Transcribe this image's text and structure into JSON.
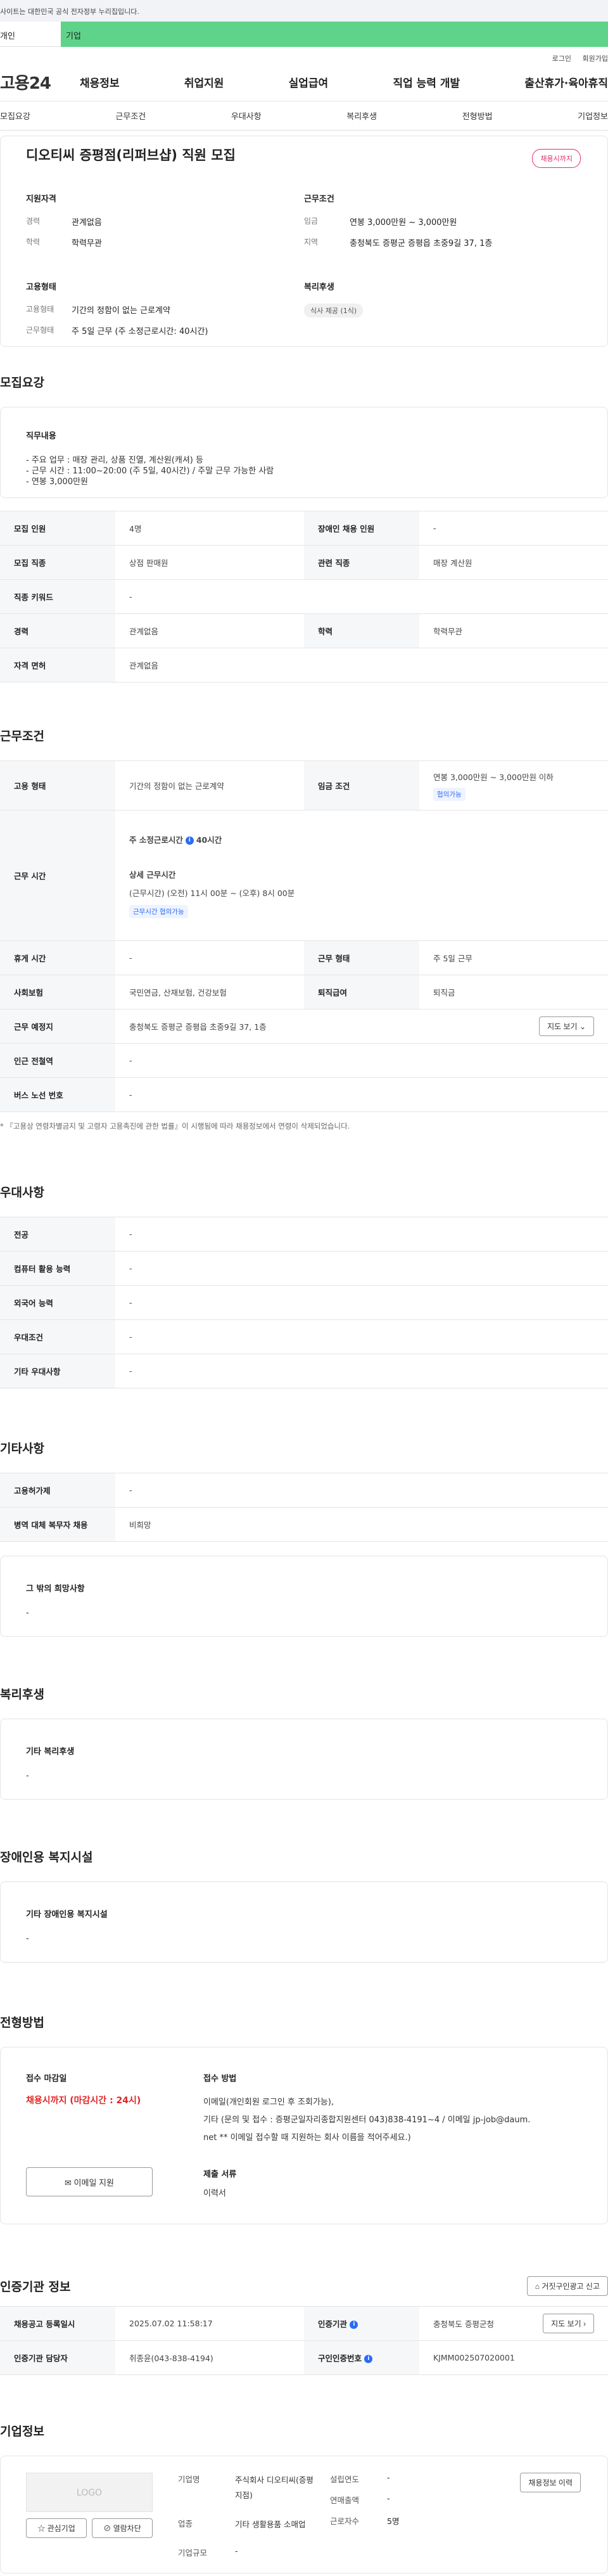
{
  "gov_banner": {
    "text": "사이트는 대한민국 공식 전자정부 누리집입니다."
  },
  "top_tabs": {
    "personal": "개인",
    "company": "기업"
  },
  "util_links": {
    "login": "로그인",
    "join": "회원가입"
  },
  "gnb": {
    "logo": "고용24",
    "items": [
      "채용정보",
      "취업지원",
      "실업급여",
      "직업 능력 개발",
      "출산휴가·육아휴직"
    ]
  },
  "subnav": [
    "모집요강",
    "근무조건",
    "우대사항",
    "복리후생",
    "전형방법",
    "기업정보"
  ],
  "summary": {
    "title": "디오티씨 증평점(리퍼브샵) 직원 모집",
    "status_badge": "채용시까지",
    "qual_head": "지원자격",
    "career_k": "경력",
    "career_v": "관계없음",
    "edu_k": "학력",
    "edu_v": "학력무관",
    "cond_head": "근무조건",
    "wage_k": "임금",
    "wage_v": "연봉 3,000만원 ~ 3,000만원",
    "region_k": "지역",
    "region_v": "충청북도 증평군 증평읍 초중9길 37, 1층",
    "emp_head": "고용형태",
    "emptype_k": "고용형태",
    "emptype_v": "기간의 정함이 없는 근로계약",
    "worktype_k": "근무형태",
    "worktype_v": "주 5일 근무 (주 소정근로시간: 40시간)",
    "welfare_head": "복리후생",
    "welfare_chip": "식사 제공 (1식)"
  },
  "recruit": {
    "section_title": "모집요강",
    "duty_title": "직무내용",
    "duty_lines": [
      "- 주요 업무 : 매장 관리, 상품 진열, 계산원(캐셔) 등",
      "- 근무 시간 : 11:00~20:00 (주 5일, 40시간) / 주말 근무 가능한 사람",
      "- 연봉 3,000만원"
    ],
    "people_k": "모집 인원",
    "people_v": "4명",
    "disabled_k": "장애인 채용 인원",
    "disabled_v": "-",
    "job_k": "모집 직종",
    "job_v": "상점 판매원",
    "related_k": "관련 직종",
    "related_v": "매장 계산원",
    "keyword_k": "직종 키워드",
    "keyword_v": "-",
    "career_k": "경력",
    "career_v": "관계없음",
    "edu_k": "학력",
    "edu_v": "학력무관",
    "license_k": "자격 면허",
    "license_v": "관계없음"
  },
  "conditions": {
    "section_title": "근무조건",
    "emptype_k": "고용 형태",
    "emptype_v": "기간의 정함이 없는 근로계약",
    "wage_k": "임금 조건",
    "wage_v": "연봉 3,000만원 ~ 3,000만원 이하",
    "wage_chip": "협의가능",
    "time_k": "근무 시간",
    "weekly_label": "주 소정근로시간",
    "weekly_value": "40시간",
    "detail_label": "상세 근무시간",
    "detail_value": "(근무시간) (오전) 11시 00분 ~ (오후) 8시 00분",
    "time_chip": "근무시간 협의가능",
    "rest_k": "휴게 시간",
    "rest_v": "-",
    "form_k": "근무 형태",
    "form_v": "주 5일 근무",
    "insurance_k": "사회보험",
    "insurance_v": "국민연금, 산재보험, 건강보험",
    "retire_k": "퇴직급여",
    "retire_v": "퇴직금",
    "place_k": "근무 예정지",
    "place_v": "충청북도 증평군 증평읍 초중9길 37, 1층",
    "map_btn": "지도 보기",
    "subway_k": "인근 전철역",
    "subway_v": "-",
    "bus_k": "버스 노선 번호",
    "bus_v": "-",
    "note": "* 『고용상 연령차별금지 및 고령자 고용촉진에 관한 법률』이 시행됨에 따라 채용정보에서 연령이 삭제되었습니다."
  },
  "preference": {
    "section_title": "우대사항",
    "rows": [
      {
        "k": "전공",
        "v": "-"
      },
      {
        "k": "컴퓨터 활용 능력",
        "v": "-"
      },
      {
        "k": "외국어 능력",
        "v": "-"
      },
      {
        "k": "우대조건",
        "v": "-"
      },
      {
        "k": "기타 우대사항",
        "v": "-"
      }
    ]
  },
  "other": {
    "section_title": "기타사항",
    "employ_k": "고용허가제",
    "employ_v": "-",
    "military_k": "병역 대체 복무자 채용",
    "military_v": "비희망",
    "box_title": "그 밖의 희망사항",
    "box_text": "-"
  },
  "welfare": {
    "section_title": "복리후생",
    "box_title": "기타 복리후생",
    "box_text": "-"
  },
  "disabled_facility": {
    "section_title": "장애인용 복지시설",
    "box_title": "기타 장애인용 복지시설",
    "box_text": "-"
  },
  "selection": {
    "section_title": "전형방법",
    "deadline_label": "접수 마감일",
    "deadline_value": "채용시까지 (마감시간 : 24시)",
    "email_btn": "이메일 지원",
    "method_label": "접수 방법",
    "method_lines": [
      "이메일(개인회원 로그인 후 조회가능),",
      "기타 (문의 및 접수 : 증평군일자리종합지원센터 043)838-4191~4 / 이메일 jp-job@daum.",
      "net ** 이메일 접수할 때 지원하는 회사 이름을 적어주세요.)"
    ],
    "docs_label": "제출 서류",
    "docs_value": "이력서"
  },
  "auth": {
    "section_title": "인증기관 정보",
    "report_btn": "거짓구인광고 신고",
    "regdate_k": "채용공고 등록일시",
    "regdate_v": "2025.07.02 11:58:17",
    "agency_k": "인증기관",
    "agency_v": "충청북도 증평군청",
    "map_btn": "지도 보기",
    "manager_k": "인증기관 담당자",
    "manager_v": "취종윤(043-838-4194)",
    "number_k": "구인인증번호",
    "number_v": "KJMM002507020001"
  },
  "company": {
    "section_title": "기업정보",
    "logo_text": "LOGO",
    "interest_btn": "관심기업",
    "block_btn": "열람차단",
    "detail_btn": "채용정보 이력",
    "name_k": "기업명",
    "name_v": "주식회사 디오티씨(증평지점)",
    "year_k": "설립연도",
    "year_v": "-",
    "sales_k": "연매출액",
    "sales_v": "-",
    "industry_k": "업종",
    "industry_v": "기타 생활용품 소매업",
    "staff_k": "근로자수",
    "staff_v": "5명",
    "size_k": "기업규모",
    "size_v": "-"
  }
}
